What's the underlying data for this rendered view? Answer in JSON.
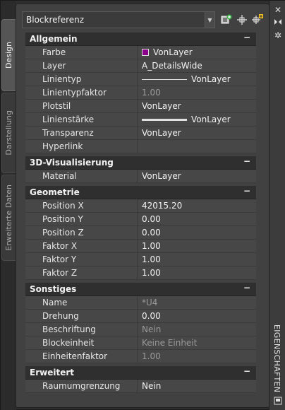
{
  "tabs": [
    "Design",
    "Darstellung",
    "Erweiterte Daten"
  ],
  "selector": {
    "value": "Blockreferenz"
  },
  "toolbar": {
    "icons": [
      "quick-select-icon",
      "select-objects-icon",
      "toggle-pickadd-icon"
    ]
  },
  "right_strip": {
    "title": "EIGENSCHAFTEN",
    "icons": [
      "close-icon",
      "autohide-icon",
      "settings-icon",
      "properties-icon"
    ]
  },
  "sections": {
    "allgemein": {
      "title": "Allgemein",
      "rows": [
        {
          "k": "Farbe",
          "v": "VonLayer"
        },
        {
          "k": "Layer",
          "v": "A_DetailsWide"
        },
        {
          "k": "Linientyp",
          "v": "VonLayer"
        },
        {
          "k": "Linientypfaktor",
          "v": "1.00"
        },
        {
          "k": "Plotstil",
          "v": "VonLayer"
        },
        {
          "k": "Linienstärke",
          "v": "VonLayer"
        },
        {
          "k": "Transparenz",
          "v": "VonLayer"
        },
        {
          "k": "Hyperlink",
          "v": ""
        }
      ]
    },
    "visual3d": {
      "title": "3D-Visualisierung",
      "rows": [
        {
          "k": "Material",
          "v": "VonLayer"
        }
      ]
    },
    "geometrie": {
      "title": "Geometrie",
      "rows": [
        {
          "k": "Position X",
          "v": "42015.20"
        },
        {
          "k": "Position Y",
          "v": "0.00"
        },
        {
          "k": "Position Z",
          "v": "0.00"
        },
        {
          "k": "Faktor X",
          "v": "1.00"
        },
        {
          "k": "Faktor Y",
          "v": "1.00"
        },
        {
          "k": "Faktor Z",
          "v": "1.00"
        }
      ]
    },
    "sonstiges": {
      "title": "Sonstiges",
      "rows": [
        {
          "k": "Name",
          "v": "*U4"
        },
        {
          "k": "Drehung",
          "v": "0.00"
        },
        {
          "k": "Beschriftung",
          "v": "Nein"
        },
        {
          "k": "Blockeinheit",
          "v": "Keine Einheit"
        },
        {
          "k": "Einheitenfaktor",
          "v": "1.00"
        }
      ]
    },
    "erweitert": {
      "title": "Erweitert",
      "rows": [
        {
          "k": "Raumumgrenzung",
          "v": "Nein"
        }
      ]
    }
  },
  "collapse_symbol": "−",
  "colors": {
    "color_swatch": "#8b008b"
  }
}
